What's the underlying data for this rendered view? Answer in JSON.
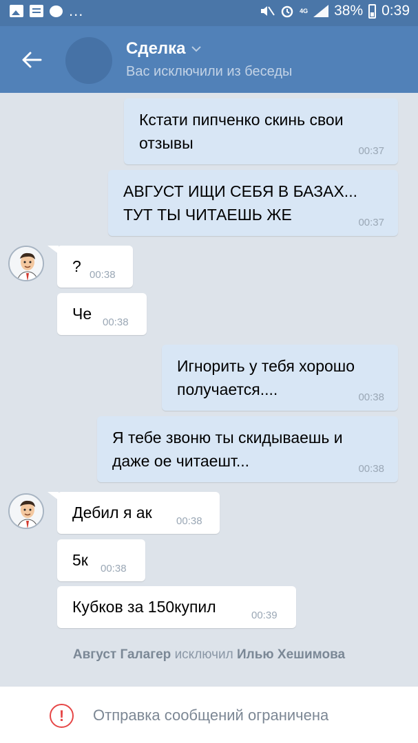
{
  "status_bar": {
    "battery": "38%",
    "time": "0:39",
    "network": "4G",
    "overflow": "..."
  },
  "header": {
    "title": "Сделка",
    "subtitle": "Вас исключили из беседы"
  },
  "messages": [
    {
      "direction": "out",
      "text": "Кстати пипченко скинь свои\nотзывы",
      "time": "00:37"
    },
    {
      "direction": "out",
      "text": "АВГУСТ ИЩИ СЕБЯ В БАЗАХ...\nТУТ ТЫ ЧИТАЕШЬ ЖЕ",
      "time": "00:37"
    },
    {
      "direction": "in",
      "text": "?",
      "time": "00:38"
    },
    {
      "direction": "in",
      "text": "Че",
      "time": "00:38"
    },
    {
      "direction": "out",
      "text": "Игнорить у тебя хорошо\nполучается....",
      "time": "00:38"
    },
    {
      "direction": "out",
      "text": "Я тебе звоню ты скидываешь и\nдаже ое читаешт...",
      "time": "00:38"
    },
    {
      "direction": "in",
      "text": "Дебил я ак",
      "time": "00:38"
    },
    {
      "direction": "in",
      "text": "5к",
      "time": "00:38"
    },
    {
      "direction": "in",
      "text": "Кубков за 150купил",
      "time": "00:39"
    }
  ],
  "service_message": {
    "actor": "Август Галагер",
    "action": "исключил",
    "target": "Илью Хешимова"
  },
  "footer": {
    "notice": "Отправка сообщений ограничена",
    "icon": "exclamation-icon"
  },
  "colors": {
    "header": "#5181b8",
    "status_bar": "#4a76a8",
    "chat_bg": "#dde3ea",
    "bubble_out": "#d8e6f5",
    "bubble_in": "#ffffff",
    "warning": "#e64646"
  }
}
